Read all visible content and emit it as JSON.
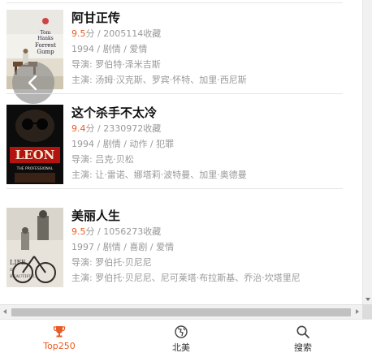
{
  "movies": [
    {
      "title": "阿甘正传",
      "rating": "9.5",
      "rating_unit": "分",
      "collect": " / 2005114收藏",
      "meta": "1994 / 剧情 / 爱情",
      "director": "导演: 罗伯特·泽米吉斯",
      "cast": "主演: 汤姆·汉克斯、罗宾·怀特、加里·西尼斯",
      "poster_text": "Tom Hanks Forrest Gump"
    },
    {
      "title": "这个杀手不太冷",
      "rating": "9.4",
      "rating_unit": "分",
      "collect": " / 2330972收藏",
      "meta": "1994 / 剧情 / 动作 / 犯罪",
      "director": "导演: 吕克·贝松",
      "cast": "主演: 让·雷诺、娜塔莉·波特曼、加里·奥德曼",
      "poster_text": "LEON THE PROFESSIONAL"
    },
    {
      "title": "美丽人生",
      "rating": "9.5",
      "rating_unit": "分",
      "collect": " / 1056273收藏",
      "meta": "1997 / 剧情 / 喜剧 / 爱情",
      "director": "导演: 罗伯托·贝尼尼",
      "cast": "主演: 罗伯托·贝尼尼、尼可莱塔·布拉斯基、乔治·坎塔里尼",
      "poster_text": "LIFE IS BEAUTIFUL"
    }
  ],
  "tabs": [
    {
      "label": "Top250",
      "icon": "trophy-icon",
      "active": true
    },
    {
      "label": "北美",
      "icon": "globe-icon",
      "active": false
    },
    {
      "label": "搜索",
      "icon": "search-icon",
      "active": false
    }
  ],
  "colors": {
    "accent": "#e95b24",
    "text_muted": "#999999"
  }
}
